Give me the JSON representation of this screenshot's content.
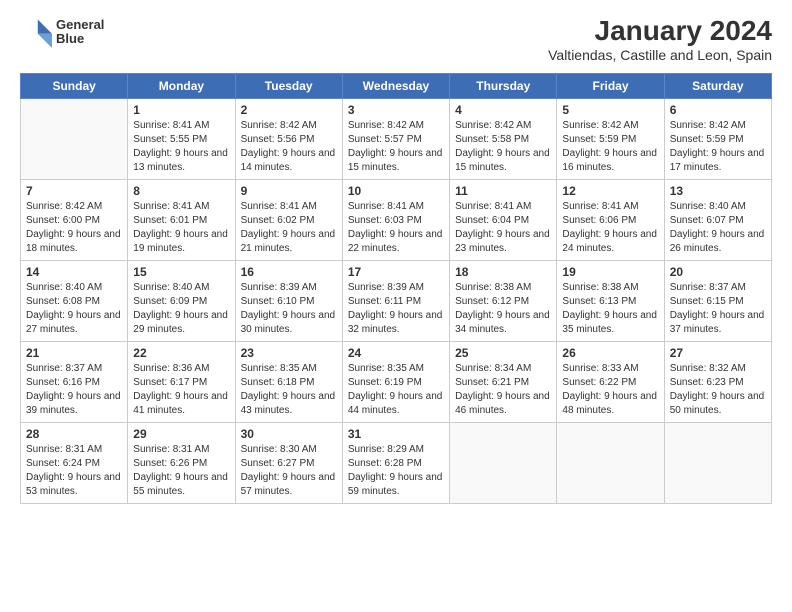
{
  "header": {
    "logo_line1": "General",
    "logo_line2": "Blue",
    "title": "January 2024",
    "subtitle": "Valtiendas, Castille and Leon, Spain"
  },
  "calendar": {
    "headers": [
      "Sunday",
      "Monday",
      "Tuesday",
      "Wednesday",
      "Thursday",
      "Friday",
      "Saturday"
    ],
    "weeks": [
      [
        {
          "day": "",
          "sunrise": "",
          "sunset": "",
          "daylight": ""
        },
        {
          "day": "1",
          "sunrise": "Sunrise: 8:41 AM",
          "sunset": "Sunset: 5:55 PM",
          "daylight": "Daylight: 9 hours and 13 minutes."
        },
        {
          "day": "2",
          "sunrise": "Sunrise: 8:42 AM",
          "sunset": "Sunset: 5:56 PM",
          "daylight": "Daylight: 9 hours and 14 minutes."
        },
        {
          "day": "3",
          "sunrise": "Sunrise: 8:42 AM",
          "sunset": "Sunset: 5:57 PM",
          "daylight": "Daylight: 9 hours and 15 minutes."
        },
        {
          "day": "4",
          "sunrise": "Sunrise: 8:42 AM",
          "sunset": "Sunset: 5:58 PM",
          "daylight": "Daylight: 9 hours and 15 minutes."
        },
        {
          "day": "5",
          "sunrise": "Sunrise: 8:42 AM",
          "sunset": "Sunset: 5:59 PM",
          "daylight": "Daylight: 9 hours and 16 minutes."
        },
        {
          "day": "6",
          "sunrise": "Sunrise: 8:42 AM",
          "sunset": "Sunset: 5:59 PM",
          "daylight": "Daylight: 9 hours and 17 minutes."
        }
      ],
      [
        {
          "day": "7",
          "sunrise": "Sunrise: 8:42 AM",
          "sunset": "Sunset: 6:00 PM",
          "daylight": "Daylight: 9 hours and 18 minutes."
        },
        {
          "day": "8",
          "sunrise": "Sunrise: 8:41 AM",
          "sunset": "Sunset: 6:01 PM",
          "daylight": "Daylight: 9 hours and 19 minutes."
        },
        {
          "day": "9",
          "sunrise": "Sunrise: 8:41 AM",
          "sunset": "Sunset: 6:02 PM",
          "daylight": "Daylight: 9 hours and 21 minutes."
        },
        {
          "day": "10",
          "sunrise": "Sunrise: 8:41 AM",
          "sunset": "Sunset: 6:03 PM",
          "daylight": "Daylight: 9 hours and 22 minutes."
        },
        {
          "day": "11",
          "sunrise": "Sunrise: 8:41 AM",
          "sunset": "Sunset: 6:04 PM",
          "daylight": "Daylight: 9 hours and 23 minutes."
        },
        {
          "day": "12",
          "sunrise": "Sunrise: 8:41 AM",
          "sunset": "Sunset: 6:06 PM",
          "daylight": "Daylight: 9 hours and 24 minutes."
        },
        {
          "day": "13",
          "sunrise": "Sunrise: 8:40 AM",
          "sunset": "Sunset: 6:07 PM",
          "daylight": "Daylight: 9 hours and 26 minutes."
        }
      ],
      [
        {
          "day": "14",
          "sunrise": "Sunrise: 8:40 AM",
          "sunset": "Sunset: 6:08 PM",
          "daylight": "Daylight: 9 hours and 27 minutes."
        },
        {
          "day": "15",
          "sunrise": "Sunrise: 8:40 AM",
          "sunset": "Sunset: 6:09 PM",
          "daylight": "Daylight: 9 hours and 29 minutes."
        },
        {
          "day": "16",
          "sunrise": "Sunrise: 8:39 AM",
          "sunset": "Sunset: 6:10 PM",
          "daylight": "Daylight: 9 hours and 30 minutes."
        },
        {
          "day": "17",
          "sunrise": "Sunrise: 8:39 AM",
          "sunset": "Sunset: 6:11 PM",
          "daylight": "Daylight: 9 hours and 32 minutes."
        },
        {
          "day": "18",
          "sunrise": "Sunrise: 8:38 AM",
          "sunset": "Sunset: 6:12 PM",
          "daylight": "Daylight: 9 hours and 34 minutes."
        },
        {
          "day": "19",
          "sunrise": "Sunrise: 8:38 AM",
          "sunset": "Sunset: 6:13 PM",
          "daylight": "Daylight: 9 hours and 35 minutes."
        },
        {
          "day": "20",
          "sunrise": "Sunrise: 8:37 AM",
          "sunset": "Sunset: 6:15 PM",
          "daylight": "Daylight: 9 hours and 37 minutes."
        }
      ],
      [
        {
          "day": "21",
          "sunrise": "Sunrise: 8:37 AM",
          "sunset": "Sunset: 6:16 PM",
          "daylight": "Daylight: 9 hours and 39 minutes."
        },
        {
          "day": "22",
          "sunrise": "Sunrise: 8:36 AM",
          "sunset": "Sunset: 6:17 PM",
          "daylight": "Daylight: 9 hours and 41 minutes."
        },
        {
          "day": "23",
          "sunrise": "Sunrise: 8:35 AM",
          "sunset": "Sunset: 6:18 PM",
          "daylight": "Daylight: 9 hours and 43 minutes."
        },
        {
          "day": "24",
          "sunrise": "Sunrise: 8:35 AM",
          "sunset": "Sunset: 6:19 PM",
          "daylight": "Daylight: 9 hours and 44 minutes."
        },
        {
          "day": "25",
          "sunrise": "Sunrise: 8:34 AM",
          "sunset": "Sunset: 6:21 PM",
          "daylight": "Daylight: 9 hours and 46 minutes."
        },
        {
          "day": "26",
          "sunrise": "Sunrise: 8:33 AM",
          "sunset": "Sunset: 6:22 PM",
          "daylight": "Daylight: 9 hours and 48 minutes."
        },
        {
          "day": "27",
          "sunrise": "Sunrise: 8:32 AM",
          "sunset": "Sunset: 6:23 PM",
          "daylight": "Daylight: 9 hours and 50 minutes."
        }
      ],
      [
        {
          "day": "28",
          "sunrise": "Sunrise: 8:31 AM",
          "sunset": "Sunset: 6:24 PM",
          "daylight": "Daylight: 9 hours and 53 minutes."
        },
        {
          "day": "29",
          "sunrise": "Sunrise: 8:31 AM",
          "sunset": "Sunset: 6:26 PM",
          "daylight": "Daylight: 9 hours and 55 minutes."
        },
        {
          "day": "30",
          "sunrise": "Sunrise: 8:30 AM",
          "sunset": "Sunset: 6:27 PM",
          "daylight": "Daylight: 9 hours and 57 minutes."
        },
        {
          "day": "31",
          "sunrise": "Sunrise: 8:29 AM",
          "sunset": "Sunset: 6:28 PM",
          "daylight": "Daylight: 9 hours and 59 minutes."
        },
        {
          "day": "",
          "sunrise": "",
          "sunset": "",
          "daylight": ""
        },
        {
          "day": "",
          "sunrise": "",
          "sunset": "",
          "daylight": ""
        },
        {
          "day": "",
          "sunrise": "",
          "sunset": "",
          "daylight": ""
        }
      ]
    ]
  }
}
